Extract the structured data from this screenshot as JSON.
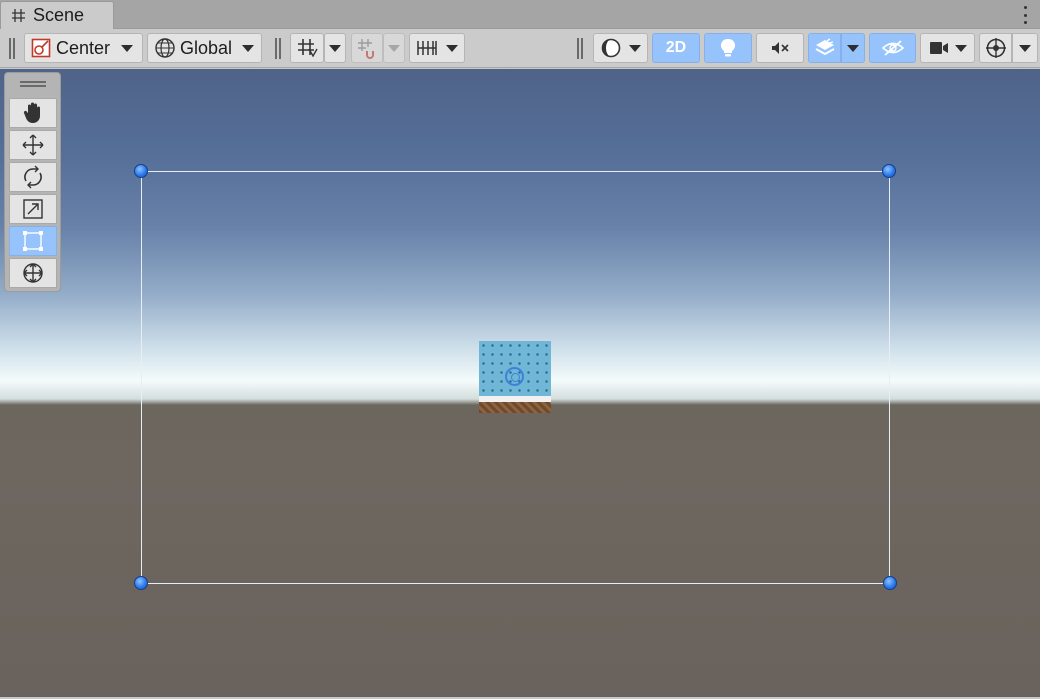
{
  "window": {
    "tab_title": "Scene",
    "tab_icon": "hash-grid-icon",
    "menu_icon": "kebab-menu-icon"
  },
  "toolbar": {
    "pivot_mode_label": "Center",
    "pivot_rotation_label": "Global",
    "mode_2d_label": "2D",
    "toggles": {
      "2d_active": true,
      "lighting_active": true,
      "audio_muted": true,
      "effects_active": true,
      "visibility_active": true,
      "snap_disabled": true
    }
  },
  "tools": {
    "items": [
      "hand-tool",
      "move-tool",
      "rotate-tool",
      "scale-tool",
      "rect-tool",
      "transform-tool"
    ],
    "active": "rect-tool"
  },
  "colors": {
    "accent": "#96c3fb",
    "toolbar_bg": "#cbcbcb",
    "handle_blue": "#2c7bef",
    "sky_top": "#4f6388",
    "horizon": "#f4fbfb",
    "ground": "#6a625c"
  }
}
